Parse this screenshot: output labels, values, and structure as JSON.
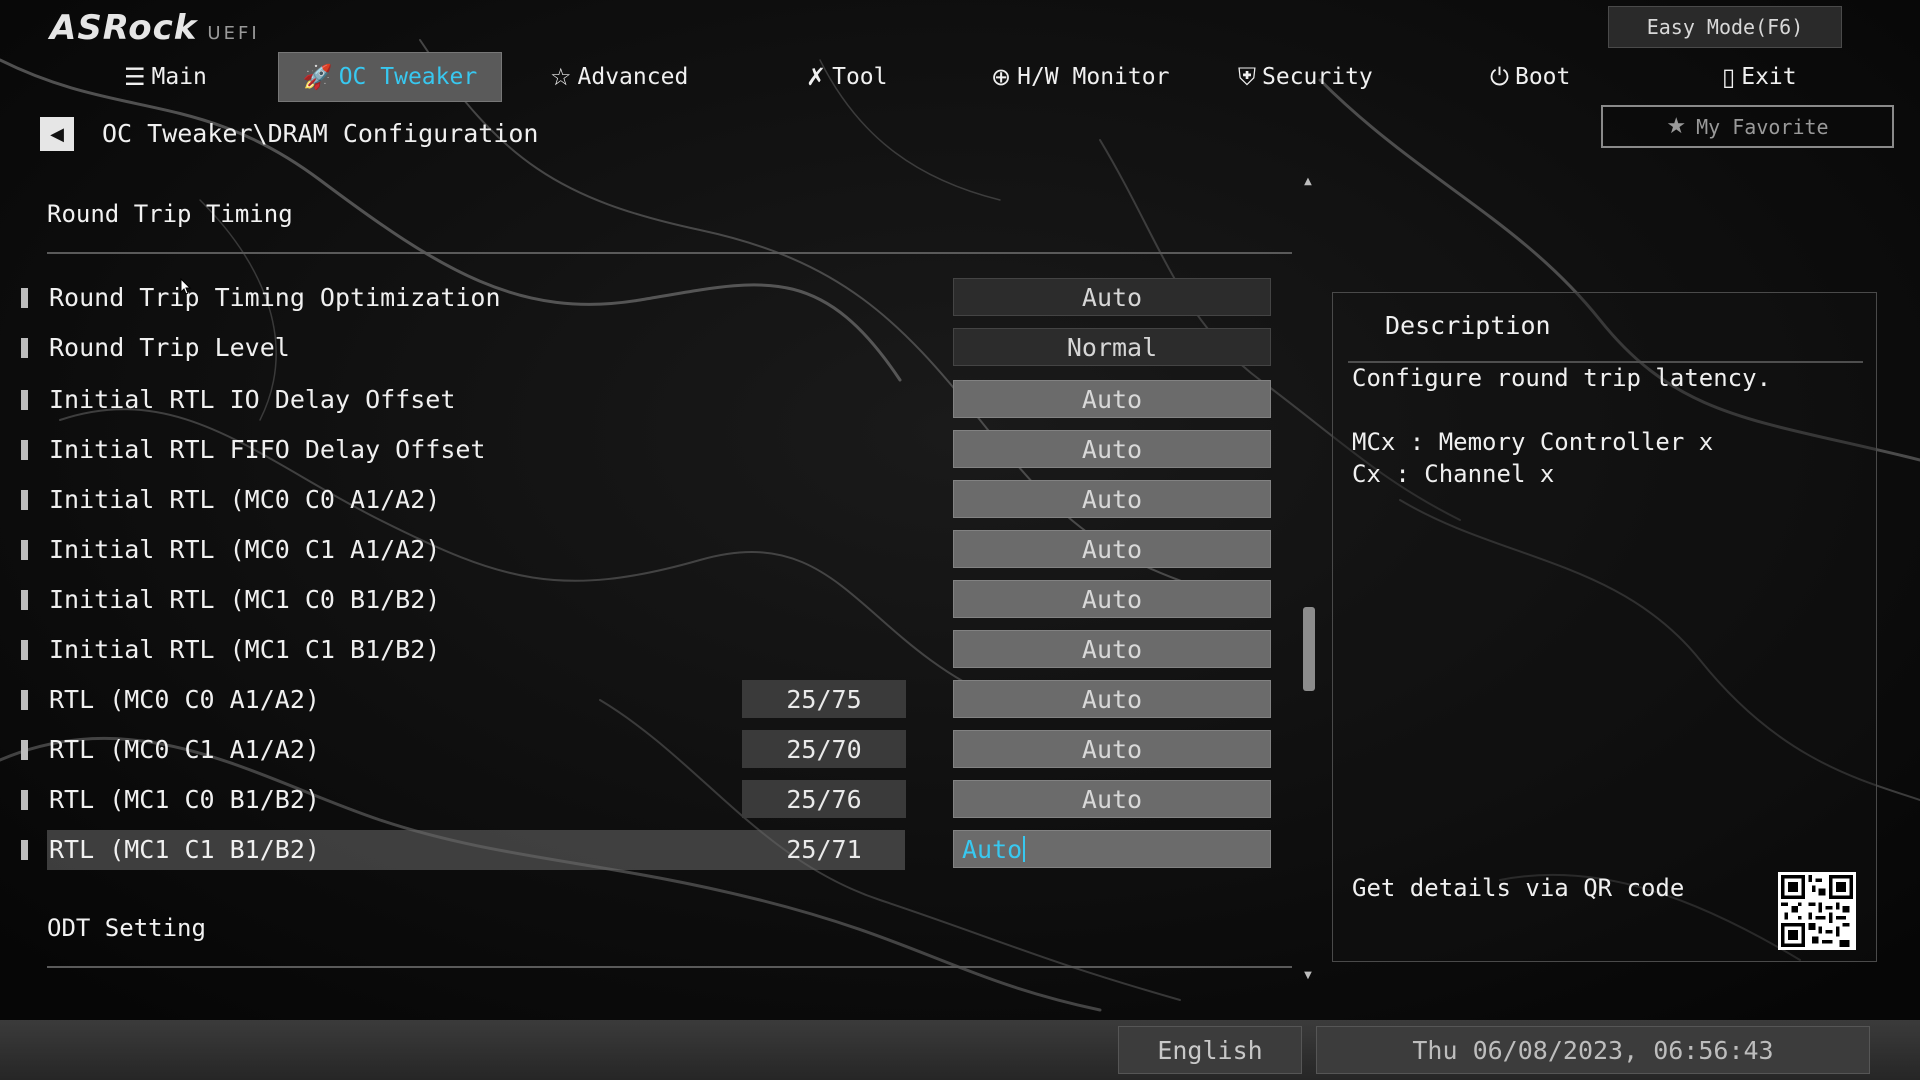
{
  "brand": {
    "logo": "ASRock",
    "sub": "UEFI"
  },
  "header": {
    "easy_mode": "Easy Mode(F6)",
    "my_favorite": "My Favorite"
  },
  "tabs": [
    {
      "label": "Main",
      "icon": "list-icon"
    },
    {
      "label": "OC Tweaker",
      "icon": "rocket-icon"
    },
    {
      "label": "Advanced",
      "icon": "star-icon"
    },
    {
      "label": "Tool",
      "icon": "tools-icon"
    },
    {
      "label": "H/W Monitor",
      "icon": "crosshair-icon"
    },
    {
      "label": "Security",
      "icon": "shield-icon"
    },
    {
      "label": "Boot",
      "icon": "power-icon"
    },
    {
      "label": "Exit",
      "icon": "door-icon"
    }
  ],
  "active_tab": "OC Tweaker",
  "breadcrumb": "OC Tweaker\\DRAM Configuration",
  "sections": {
    "round_trip": "Round Trip Timing",
    "odt": "ODT Setting"
  },
  "settings": [
    {
      "label": "Round Trip Timing Optimization",
      "value": "Auto"
    },
    {
      "label": "Round Trip Level",
      "value": "Normal"
    },
    {
      "label": "Initial RTL IO Delay Offset",
      "value": "Auto"
    },
    {
      "label": "Initial RTL FIFO Delay Offset",
      "value": "Auto"
    },
    {
      "label": "Initial RTL (MC0 C0 A1/A2)",
      "value": "Auto"
    },
    {
      "label": "Initial RTL (MC0 C1 A1/A2)",
      "value": "Auto"
    },
    {
      "label": "Initial RTL (MC1 C0 B1/B2)",
      "value": "Auto"
    },
    {
      "label": "Initial RTL (MC1 C1 B1/B2)",
      "value": "Auto"
    },
    {
      "label": "RTL (MC0 C0 A1/A2)",
      "current": "25/75",
      "value": "Auto"
    },
    {
      "label": "RTL (MC0 C1 A1/A2)",
      "current": "25/70",
      "value": "Auto"
    },
    {
      "label": "RTL (MC1 C0 B1/B2)",
      "current": "25/76",
      "value": "Auto"
    },
    {
      "label": "RTL (MC1 C1 B1/B2)",
      "current": "25/71",
      "value": "Auto"
    }
  ],
  "selected_setting": "RTL (MC1 C1 B1/B2)",
  "description": {
    "title": "Description",
    "line1": "Configure round trip latency.",
    "line2": "MCx : Memory Controller x",
    "line3": "Cx : Channel x",
    "qr_hint": "Get details via QR code"
  },
  "footer": {
    "language": "English",
    "datetime": "Thu 06/08/2023, 06:56:43"
  },
  "colors": {
    "accent": "#38c8f0",
    "tab_active_bg": "#5a5a5a",
    "field_gray": "#6b6b6b"
  }
}
